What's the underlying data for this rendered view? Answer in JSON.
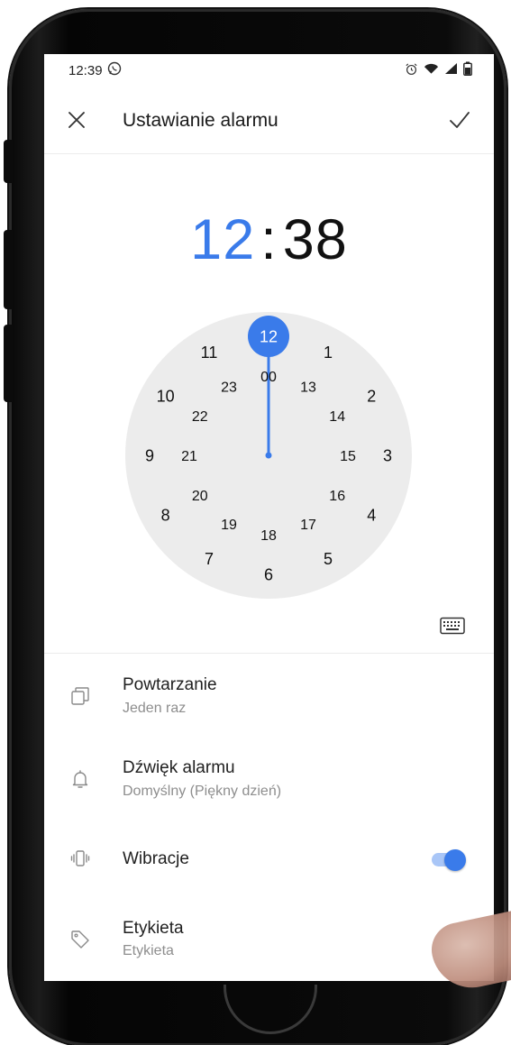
{
  "status_bar": {
    "time": "12:39",
    "left_icons": [
      "whatsapp-icon"
    ],
    "right_icons": [
      "alarm-clock-icon",
      "wifi-icon",
      "signal-icon",
      "battery-icon"
    ]
  },
  "header": {
    "title": "Ustawianie alarmu",
    "close_icon": "close-icon",
    "confirm_icon": "check-icon"
  },
  "time_display": {
    "hours": "12",
    "separator": ":",
    "minutes": "38",
    "active_color": "#3a7bea",
    "inactive_color": "#111111"
  },
  "clock_face": {
    "outer_numbers": [
      "12",
      "1",
      "2",
      "3",
      "4",
      "5",
      "6",
      "7",
      "8",
      "9",
      "10",
      "11"
    ],
    "inner_numbers": [
      "00",
      "13",
      "14",
      "15",
      "16",
      "17",
      "18",
      "19",
      "20",
      "21",
      "22",
      "23"
    ],
    "selected_value": "12",
    "face_color": "#ececec",
    "hand_color": "#3a7bea"
  },
  "keyboard_toggle": "keyboard-icon",
  "settings": {
    "repeat": {
      "label": "Powtarzanie",
      "value": "Jeden raz",
      "icon": "copy-icon"
    },
    "sound": {
      "label": "Dźwięk alarmu",
      "value": "Domyślny (Piękny dzień)",
      "icon": "bell-icon"
    },
    "vibration": {
      "label": "Wibracje",
      "icon": "vibrate-icon",
      "enabled": true
    },
    "tag": {
      "label": "Etykieta",
      "value": "Etykieta",
      "icon": "tag-icon"
    }
  }
}
